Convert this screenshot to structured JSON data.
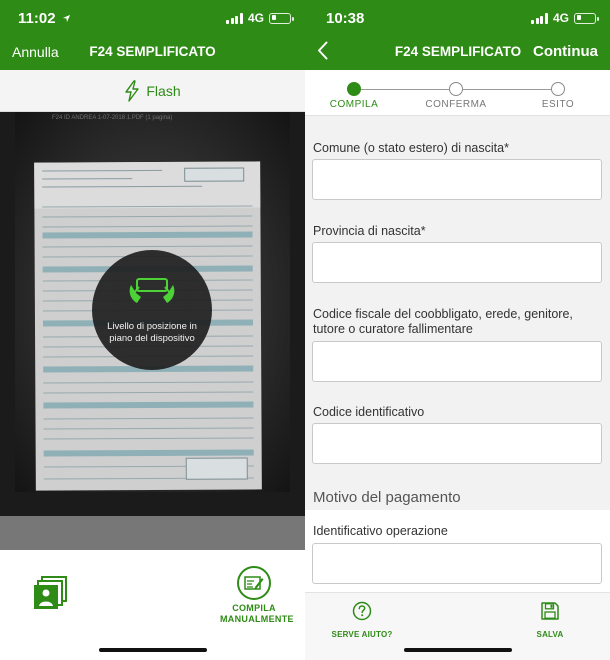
{
  "left_screen": {
    "status": {
      "time": "11:02",
      "network": "4G"
    },
    "nav": {
      "left_button": "Annulla",
      "title": "F24 SEMPLIFICATO"
    },
    "flash": {
      "label": "Flash",
      "icon": "lightning-icon"
    },
    "camera": {
      "scan_caption": "F24 ID ANDREA 1-07-2018 1.PDF (1 pagina)",
      "overlay_text": "Livello di posizione in piano del dispositivo",
      "overlay_icon": "phone-level-hands-icon"
    },
    "bottom": {
      "gallery_icon": "photo-gallery-icon",
      "manual_label": "COMPILA MANUALMENTE",
      "manual_icon": "form-edit-icon"
    }
  },
  "right_screen": {
    "status": {
      "time": "10:38",
      "network": "4G"
    },
    "nav": {
      "back_icon": "chevron-left-icon",
      "title": "F24 SEMPLIFICATO",
      "right_button": "Continua"
    },
    "steps": [
      {
        "label": "COMPILA",
        "active": true
      },
      {
        "label": "CONFERMA",
        "active": false
      },
      {
        "label": "ESITO",
        "active": false
      }
    ],
    "form": {
      "fields": [
        {
          "label": "Comune (o stato estero) di nascita*",
          "value": ""
        },
        {
          "label": "Provincia di nascita*",
          "value": ""
        },
        {
          "label": "Codice fiscale del coobbligato, erede, genitore, tutore o curatore fallimentare",
          "value": ""
        },
        {
          "label": "Codice identificativo",
          "value": ""
        }
      ],
      "section_title": "Motivo del pagamento",
      "section_fields": [
        {
          "label": "Identificativo operazione",
          "value": ""
        }
      ]
    },
    "bottom": {
      "help_label": "SERVE AIUTO?",
      "help_icon": "question-circle-icon",
      "save_label": "SALVA",
      "save_icon": "floppy-disk-icon"
    }
  },
  "colors": {
    "brand_green": "#2e8b16",
    "overlay_dark": "#202020",
    "viewfinder_bg": "#1b1b1b"
  }
}
